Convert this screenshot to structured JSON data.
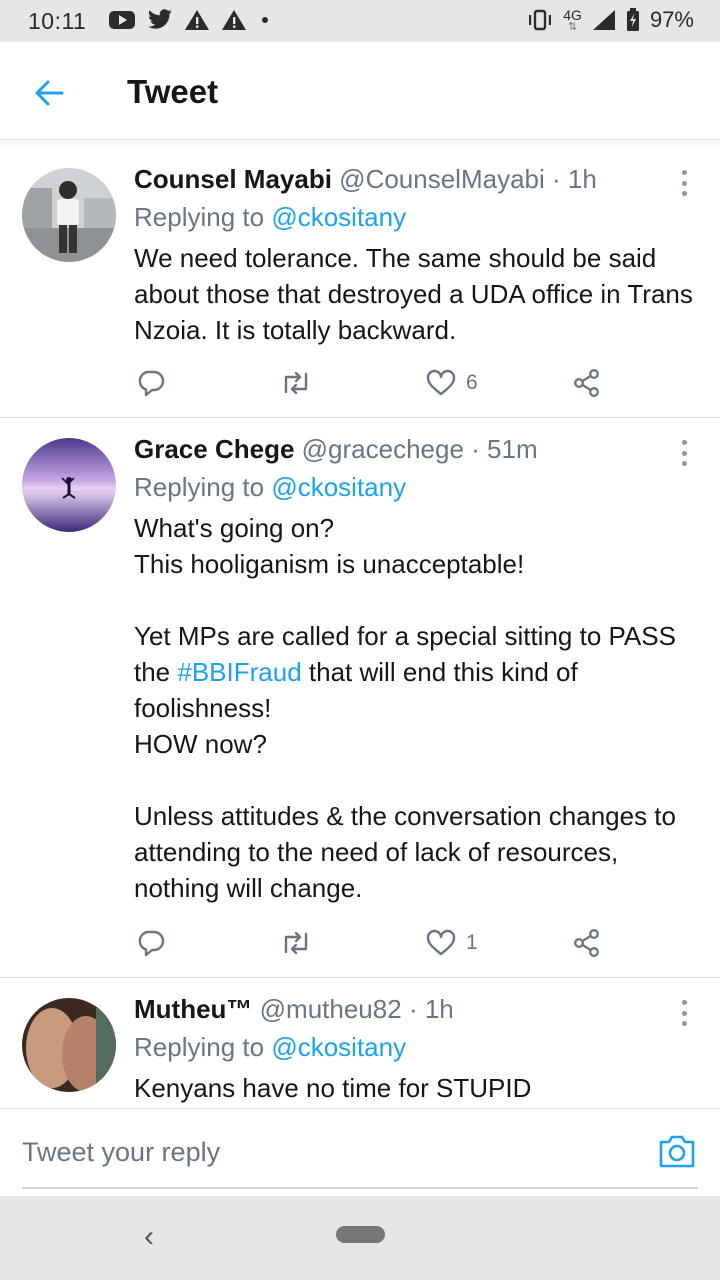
{
  "status_bar": {
    "time": "10:11",
    "network": "4G",
    "battery": "97%"
  },
  "header": {
    "title": "Tweet"
  },
  "tweets": [
    {
      "name": "Counsel Mayabi",
      "handle": "@CounselMayabi",
      "time": "· 1h",
      "replying_prefix": "Replying to",
      "replying_to": "@ckositany",
      "text": "We need tolerance. The same should be said about those that destroyed a UDA office in Trans Nzoia. It is totally backward.",
      "likes": "6"
    },
    {
      "name": "Grace Chege",
      "handle": "@gracechege",
      "time": "· 51m",
      "replying_prefix": "Replying to",
      "replying_to": "@ckositany",
      "text_parts": {
        "p1": "What's going on?\nThis hooliganism is unacceptable!",
        "p2_before": "Yet MPs are called for a special sitting to PASS the ",
        "p2_hashtag": "#BBIFraud",
        "p2_after": " that will end this kind of foolishness!\nHOW now?",
        "p3": "Unless attitudes & the conversation changes to attending to the need of lack of resources, nothing will change."
      },
      "likes": "1"
    },
    {
      "name": "Mutheu™",
      "handle": "@mutheu82",
      "time": "· 1h",
      "replying_prefix": "Replying to",
      "replying_to": "@ckositany",
      "text": "Kenyans have no time for STUPID"
    }
  ],
  "reply_bar": {
    "placeholder": "Tweet your reply"
  },
  "colors": {
    "accent": "#1da1f2",
    "secondary_text": "#657786",
    "divider": "#dfe3e6"
  }
}
